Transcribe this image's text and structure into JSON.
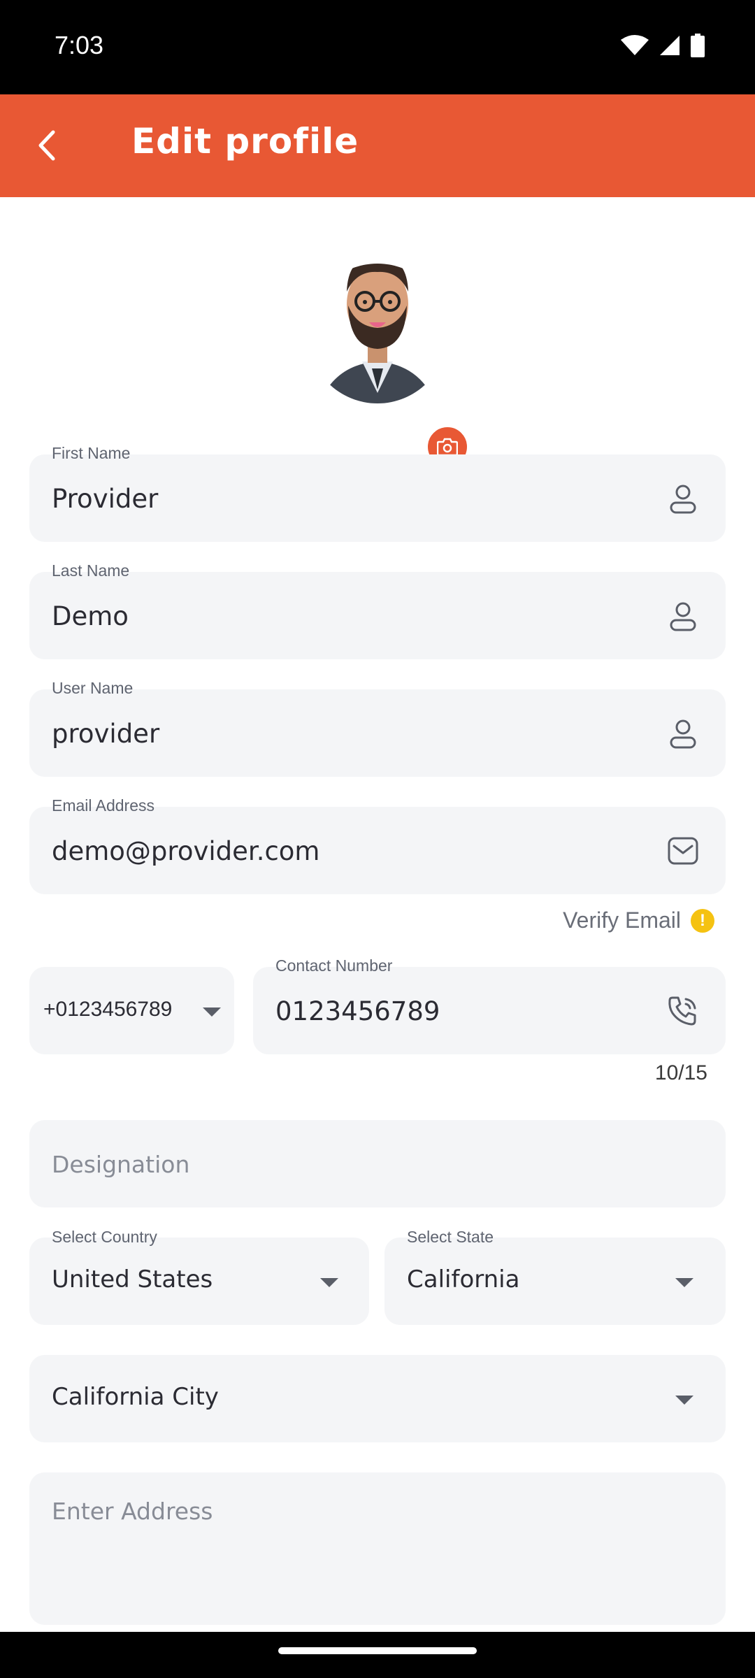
{
  "status": {
    "time": "7:03"
  },
  "app_bar": {
    "title": "Edit profile"
  },
  "form": {
    "first_name": {
      "label": "First Name",
      "value": "Provider"
    },
    "last_name": {
      "label": "Last Name",
      "value": "Demo"
    },
    "user_name": {
      "label": "User Name",
      "value": "provider"
    },
    "email": {
      "label": "Email Address",
      "value": "demo@provider.com"
    },
    "verify_email": "Verify Email",
    "country_code": "+0123456789",
    "contact": {
      "label": "Contact Number",
      "value": "0123456789",
      "counter": "10/15"
    },
    "designation": {
      "placeholder": "Designation"
    },
    "country": {
      "label": "Select Country",
      "value": "United States"
    },
    "state": {
      "label": "Select State",
      "value": "California"
    },
    "city": {
      "value": "California City"
    },
    "address": {
      "placeholder": "Enter Address"
    }
  },
  "colors": {
    "accent": "#E85834",
    "field_bg": "#F4F5F7",
    "warning": "#F5C211"
  }
}
